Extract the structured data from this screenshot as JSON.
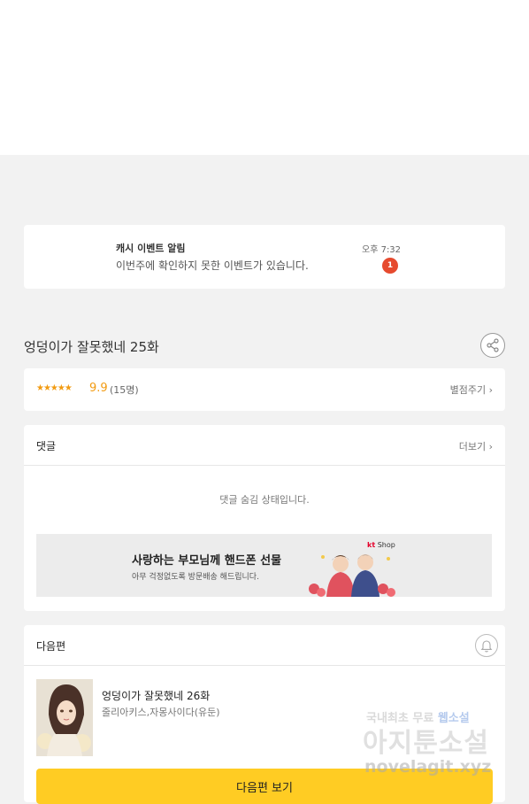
{
  "notification": {
    "title": "캐시 이벤트 알림",
    "message": "이번주에 확인하지 못한 이벤트가 있습니다.",
    "time": "오후 7:32",
    "badge": "1",
    "badge_color": "#e64a2e"
  },
  "episode": {
    "title": "엉덩이가 잘못했네 25화",
    "share_icon": "share-icon"
  },
  "rating": {
    "stars": "★★★★★",
    "score": "9.9",
    "count": "(15명)",
    "rate_link": "별점주기 ›",
    "star_color": "#f29b12"
  },
  "comments": {
    "title": "댓글",
    "more": "더보기 ›",
    "hidden_message": "댓글 숨김 상태입니다."
  },
  "ad": {
    "title": "사랑하는 부모님께 핸드폰 선물",
    "subtitle": "아무 걱정없도록 방문배송 해드립니다.",
    "brand_kt": "kt",
    "brand_shop": "Shop"
  },
  "next_episode": {
    "section_title": "다음편",
    "bell_icon": "bell-icon",
    "title": "엉덩이가 잘못했네 26화",
    "author": "줄리아키스,자몽사이다(유둔)",
    "button_label": "다음편 보기",
    "button_color": "#ffcc23"
  },
  "watermark": {
    "line1_a": "국내최초 무료",
    "line1_b": "웹소설",
    "line2": "아지툰소설",
    "line3": "novelagit.xyz"
  }
}
